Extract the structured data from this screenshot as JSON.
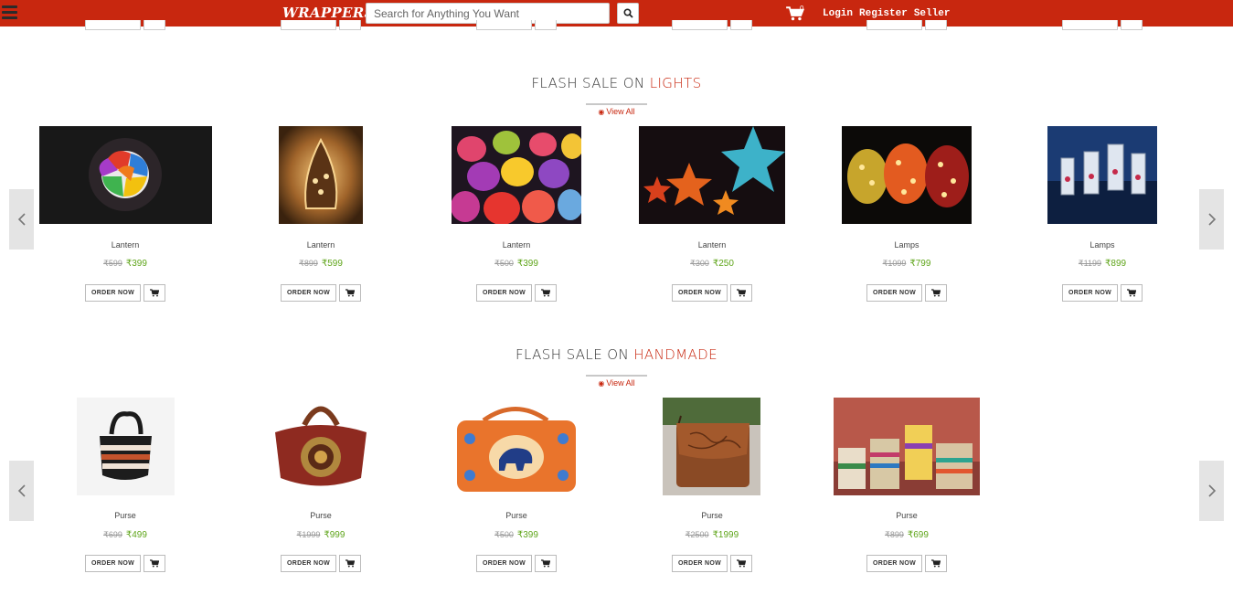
{
  "header": {
    "logo": "WRAPPERS",
    "search_placeholder": "Search for Anything You Want",
    "cart_count": "0",
    "links": [
      "Login",
      "Register",
      "Seller"
    ]
  },
  "colors": {
    "brand": "#c8270f",
    "price_green": "#5fa51a"
  },
  "sections": [
    {
      "title_prefix": "FLASH SALE ON ",
      "title_accent": "LIGHTS",
      "view_all": "View All",
      "products": [
        {
          "name": "Lantern",
          "old_price": "₹599",
          "new_price": "₹399",
          "image": "lantern-colorful-ball"
        },
        {
          "name": "Lantern",
          "old_price": "₹899",
          "new_price": "₹599",
          "image": "lantern-glowing-lamp"
        },
        {
          "name": "Lantern",
          "old_price": "₹500",
          "new_price": "₹399",
          "image": "lantern-paper-lanterns"
        },
        {
          "name": "Lantern",
          "old_price": "₹300",
          "new_price": "₹250",
          "image": "lantern-star-lanterns"
        },
        {
          "name": "Lamps",
          "old_price": "₹1099",
          "new_price": "₹799",
          "image": "lamps-mosaic"
        },
        {
          "name": "Lamps",
          "old_price": "₹1199",
          "new_price": "₹899",
          "image": "lamps-hanging-lanterns"
        }
      ]
    },
    {
      "title_prefix": "FLASH SALE ON ",
      "title_accent": "HANDMADE",
      "view_all": "View All",
      "products": [
        {
          "name": "Purse",
          "old_price": "₹699",
          "new_price": "₹499",
          "image": "purse-crochet"
        },
        {
          "name": "Purse",
          "old_price": "₹1999",
          "new_price": "₹999",
          "image": "purse-red-leather"
        },
        {
          "name": "Purse",
          "old_price": "₹500",
          "new_price": "₹399",
          "image": "purse-embroidered-elephant"
        },
        {
          "name": "Purse",
          "old_price": "₹2500",
          "new_price": "₹1999",
          "image": "purse-tooled-leather"
        },
        {
          "name": "Purse",
          "old_price": "₹899",
          "new_price": "₹699",
          "image": "purse-woven-baskets"
        }
      ]
    }
  ],
  "buttons": {
    "order_now": "ORDER NOW"
  }
}
